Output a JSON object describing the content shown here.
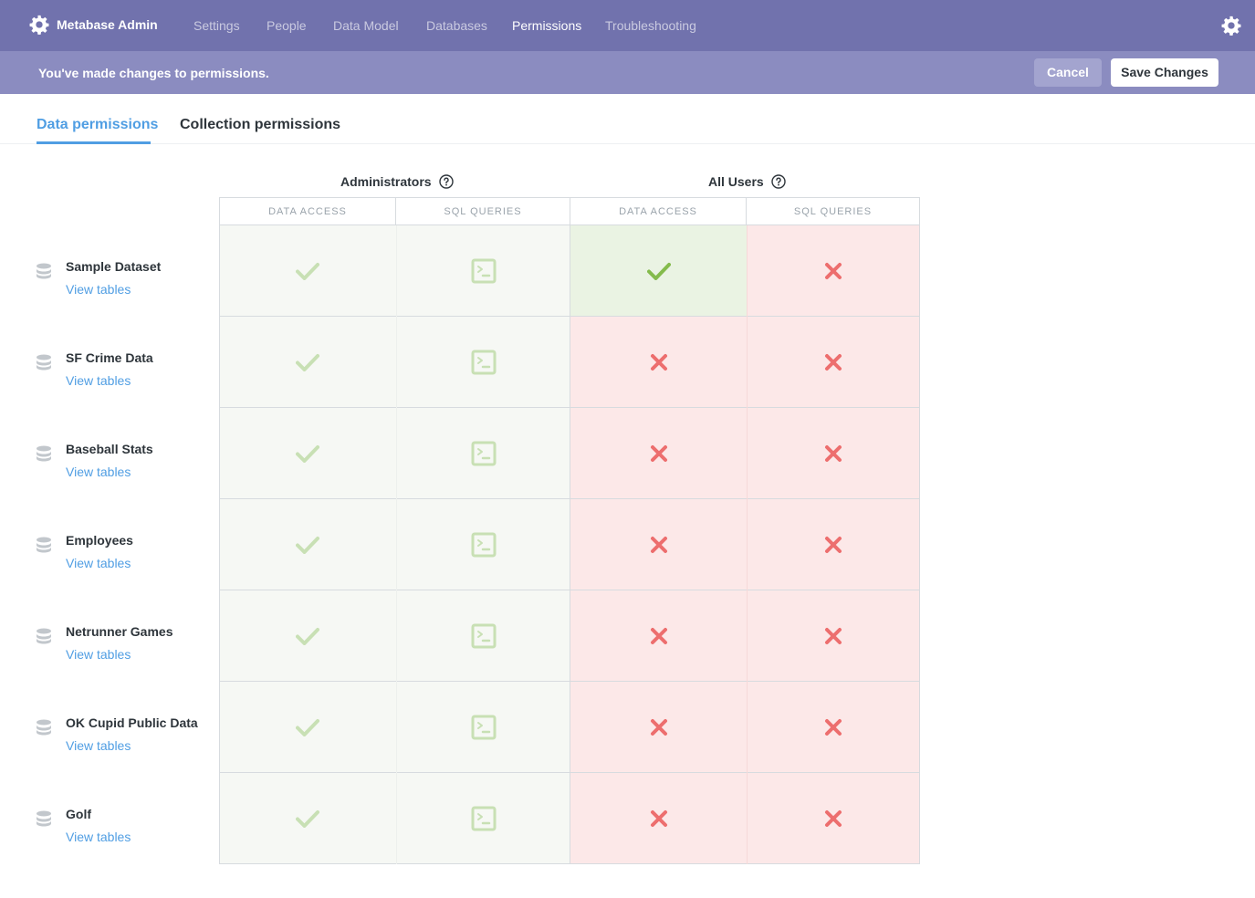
{
  "app": {
    "name": "Metabase Admin"
  },
  "nav": {
    "items": [
      {
        "label": "Settings",
        "active": false
      },
      {
        "label": "People",
        "active": false
      },
      {
        "label": "Data Model",
        "active": false
      },
      {
        "label": "Databases",
        "active": false
      },
      {
        "label": "Permissions",
        "active": true
      },
      {
        "label": "Troubleshooting",
        "active": false
      }
    ]
  },
  "banner": {
    "message": "You've made changes to permissions.",
    "cancel_label": "Cancel",
    "save_label": "Save Changes"
  },
  "tabs": [
    {
      "label": "Data permissions",
      "active": true
    },
    {
      "label": "Collection permissions",
      "active": false
    }
  ],
  "groups": [
    {
      "name": "Administrators",
      "columns": [
        "DATA ACCESS",
        "SQL QUERIES"
      ]
    },
    {
      "name": "All Users",
      "columns": [
        "DATA ACCESS",
        "SQL QUERIES"
      ]
    }
  ],
  "link_label": "View tables",
  "databases": [
    {
      "name": "Sample Dataset",
      "admin_data": "granted",
      "admin_sql": "granted",
      "users_data": "granted",
      "users_sql": "denied"
    },
    {
      "name": "SF Crime Data",
      "admin_data": "granted",
      "admin_sql": "granted",
      "users_data": "denied",
      "users_sql": "denied"
    },
    {
      "name": "Baseball Stats",
      "admin_data": "granted",
      "admin_sql": "granted",
      "users_data": "denied",
      "users_sql": "denied"
    },
    {
      "name": "Employees",
      "admin_data": "granted",
      "admin_sql": "granted",
      "users_data": "denied",
      "users_sql": "denied"
    },
    {
      "name": "Netrunner Games",
      "admin_data": "granted",
      "admin_sql": "granted",
      "users_data": "denied",
      "users_sql": "denied"
    },
    {
      "name": "OK Cupid Public Data",
      "admin_data": "granted",
      "admin_sql": "granted",
      "users_data": "denied",
      "users_sql": "denied"
    },
    {
      "name": "Golf",
      "admin_data": "granted",
      "admin_sql": "granted",
      "users_data": "denied",
      "users_sql": "denied"
    }
  ],
  "colors": {
    "nav_bg": "#7172ad",
    "banner_bg": "#8b8cc0",
    "brand_blue": "#509ee3",
    "granted_green": "#84bb4c",
    "granted_faded": "#c8e0b4",
    "denied_red": "#ed6e6e"
  }
}
